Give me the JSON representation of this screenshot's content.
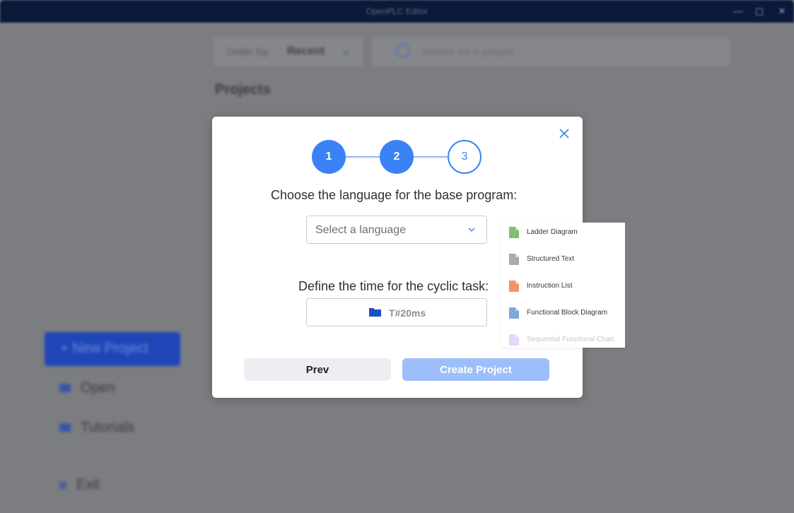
{
  "window": {
    "title": "OpenPLC Editor",
    "controls": [
      "—",
      "▢",
      "✕"
    ]
  },
  "background": {
    "order_by_label": "Order by:",
    "order_by_value": "Recent",
    "search_placeholder": "Search for a project",
    "projects_heading": "Projects",
    "sidebar": {
      "new_project": "+  New Project",
      "open": "Open",
      "tutorials": "Tutorials",
      "exit": "Exit"
    }
  },
  "modal": {
    "steps": [
      {
        "label": "1",
        "state": "done"
      },
      {
        "label": "2",
        "state": "done"
      },
      {
        "label": "3",
        "state": "todo"
      }
    ],
    "language_question": "Choose the language for the base program:",
    "language_placeholder": "Select a language",
    "cyclic_question": "Define the time for the cyclic task:",
    "cyclic_value": "T#20ms",
    "prev_label": "Prev",
    "create_label": "Create Project"
  },
  "language_options": [
    {
      "label": "Ladder Diagram",
      "color": "#7cc06e",
      "disabled": false
    },
    {
      "label": "Structured Text",
      "color": "#a9abb0",
      "disabled": false
    },
    {
      "label": "Instruction List",
      "color": "#f0936c",
      "disabled": false
    },
    {
      "label": "Functional Block Diagram",
      "color": "#7fa8d8",
      "disabled": false
    },
    {
      "label": "Sequential Functional Chart",
      "color": "#c9a8f0",
      "disabled": true
    }
  ],
  "colors": {
    "accent": "#3b82f6",
    "create_disabled": "#9dbff9"
  }
}
